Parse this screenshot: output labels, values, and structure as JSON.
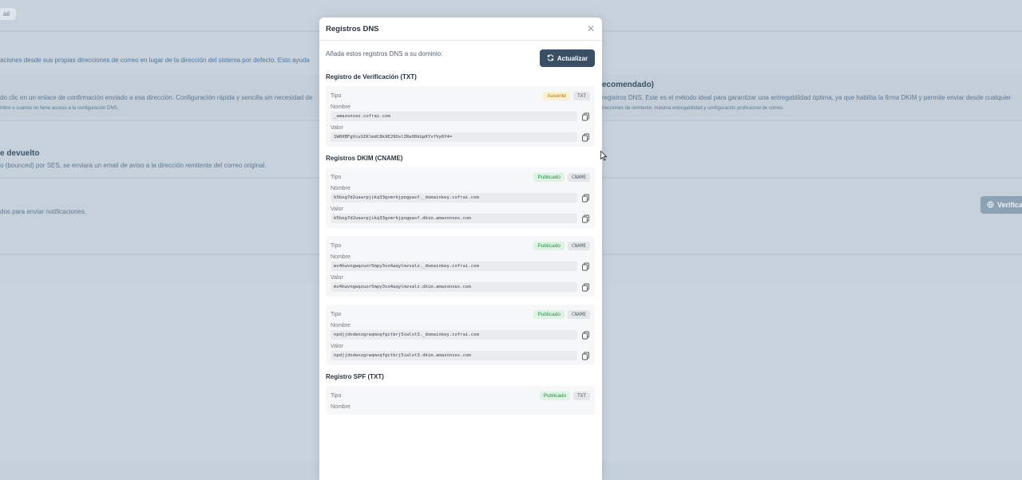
{
  "background": {
    "top_pill": "ail",
    "line1": "aciones desde sus propias direcciones de correo en lugar de la dirección del sistema por defecto. Esto ayuda",
    "line2": "do clic en un enlace de confirmación enviado a esa dirección. Configuración rápida y sencilla sin necesidad de",
    "line3": "mbre o cuando no tiene acceso a la configuración DNS.",
    "right_heading": "ecomendado)",
    "right_line1": "registros DNS. Este es el método ideal para garantizar una entregabilidad óptima, ya que habilita la firma DKIM y permite enviar desde cualquier",
    "right_line2": "irecciones de remitente, máxima entregabilidad y configuración profesional de correo.",
    "bounce_heading": "e devuelto",
    "bounce_text": "o (bounced) por SES, se enviará un email de aviso a la dirección remitente del correo original.",
    "notify_text": "dos para enviar notificaciones.",
    "verify_button": "Verifica"
  },
  "modal": {
    "title": "Registros DNS",
    "close_icon": "close-icon",
    "intro": "Añada estos registros DNS a su dominio:",
    "refresh_label": "Actualizar",
    "labels": {
      "tipo": "Tipo",
      "nombre": "Nombre",
      "valor": "Valor"
    },
    "verification": {
      "title": "Registro de Verificación (TXT)",
      "status": "Ausente",
      "type": "TXT",
      "name": "_amazonses.cofrai.com",
      "value": "1W0XBFgVcuSIKlmdC8k9EJ9OslIReO0kGpKYvfVy6Y4="
    },
    "dkim": {
      "title": "Registros DKIM (CNAME)",
      "records": [
        {
          "status": "Publicado",
          "type": "CNAME",
          "name": "k5bog7d2uaarpjikq33gxmrkjpogpasf._domainkey.cofrai.com",
          "value": "k5bog7d2uaarpjikq33gxmrkjpogpasf.dkim.amazonses.com"
        },
        {
          "status": "Publicado",
          "type": "CNAME",
          "name": "mv4hwvngwqzuor5mpy3so4aqylmzvalz._domainkey.cofrai.com",
          "value": "mv4hwvngwqzuor5mpy3so4aqylmzvalz.dkim.amazonses.com"
        },
        {
          "status": "Publicado",
          "type": "CNAME",
          "name": "npdjjdodenzgrwqmxqfgctkrj5iwlxt3._domainkey.cofrai.com",
          "value": "npdjjdodenzgrwqmxqfgctkrj5iwlxt3.dkim.amazonses.com"
        }
      ]
    },
    "spf": {
      "title": "Registro SPF (TXT)",
      "status": "Publicado",
      "type": "TXT"
    }
  }
}
